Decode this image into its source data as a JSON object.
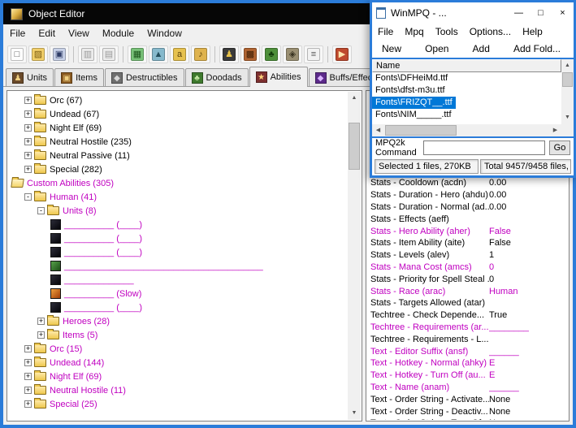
{
  "colors": {
    "frame_blue": "#2b7cd9",
    "custom_magenta": "#c000c0",
    "selection_blue": "#0078d7",
    "titlebar_black": "#060606"
  },
  "editor": {
    "title": "Object Editor",
    "menus": [
      "File",
      "Edit",
      "View",
      "Module",
      "Window"
    ],
    "toolbar_groups": [
      [
        {
          "name": "new-icon",
          "glyph": "□",
          "bg": "#fdfdfd",
          "fg": "#555555"
        },
        {
          "name": "open-folder-icon",
          "glyph": "▨",
          "bg": "#f2cf6a",
          "fg": "#7a5c12"
        },
        {
          "name": "save-icon",
          "glyph": "▣",
          "bg": "#c9d2e8",
          "fg": "#2e3c66"
        }
      ],
      [
        {
          "name": "copy-icon",
          "glyph": "▥",
          "bg": "#ececec",
          "fg": "#9a9a9a"
        },
        {
          "name": "paste-icon",
          "glyph": "▤",
          "bg": "#ececec",
          "fg": "#9a9a9a"
        }
      ],
      [
        {
          "name": "terrain-icon",
          "glyph": "▦",
          "bg": "#79c279",
          "fg": "#1c551c"
        },
        {
          "name": "mountain-icon",
          "glyph": "▲",
          "bg": "#86b9cc",
          "fg": "#234e5c"
        },
        {
          "name": "text-a-icon",
          "glyph": "a",
          "bg": "#e6c14e",
          "fg": "#5a420c"
        },
        {
          "name": "sound-icon",
          "glyph": "♪",
          "bg": "#dfb34e",
          "fg": "#5a420c"
        }
      ],
      [
        {
          "name": "units-icon",
          "glyph": "♟",
          "bg": "#3b3b3b",
          "fg": "#e8c34a"
        },
        {
          "name": "buildings-icon",
          "glyph": "▩",
          "bg": "#b06432",
          "fg": "#3f1f06"
        },
        {
          "name": "trees-icon",
          "glyph": "♣",
          "bg": "#4e8f3a",
          "fg": "#133b0b"
        },
        {
          "name": "doodads-icon",
          "glyph": "◈",
          "bg": "#9a8f72",
          "fg": "#38321f"
        },
        {
          "name": "script-icon",
          "glyph": "≡",
          "bg": "#f2f2f2",
          "fg": "#555555"
        }
      ],
      [
        {
          "name": "test-icon",
          "glyph": "▶",
          "bg": "#bf4a2e",
          "fg": "#ffe6ae"
        }
      ]
    ],
    "tabs": [
      {
        "label": "Units",
        "active": false,
        "icon": {
          "glyph": "♟",
          "bg": "#6b4a2a",
          "fg": "#f0d080"
        }
      },
      {
        "label": "Items",
        "active": false,
        "icon": {
          "glyph": "▣",
          "bg": "#8a5a20",
          "fg": "#f0d080"
        }
      },
      {
        "label": "Destructibles",
        "active": false,
        "icon": {
          "glyph": "◆",
          "bg": "#6f6f6f",
          "fg": "#d8d8d8"
        }
      },
      {
        "label": "Doodads",
        "active": false,
        "icon": {
          "glyph": "♣",
          "bg": "#3f7a2e",
          "fg": "#c6eaa6"
        }
      },
      {
        "label": "Abilities",
        "active": true,
        "icon": {
          "glyph": "★",
          "bg": "#7e3030",
          "fg": "#ffd27a"
        }
      },
      {
        "label": "Buffs/Effects",
        "active": false,
        "icon": {
          "glyph": "◆",
          "bg": "#5c2a8a",
          "fg": "#d9b3ff"
        }
      }
    ],
    "tree": [
      {
        "level": 1,
        "box": "+",
        "icon": "folder",
        "label": "Orc (67)",
        "custom": false
      },
      {
        "level": 1,
        "box": "+",
        "icon": "folder",
        "label": "Undead (67)",
        "custom": false
      },
      {
        "level": 1,
        "box": "+",
        "icon": "folder",
        "label": "Night Elf (69)",
        "custom": false
      },
      {
        "level": 1,
        "box": "+",
        "icon": "folder",
        "label": "Neutral Hostile (235)",
        "custom": false
      },
      {
        "level": 1,
        "box": "+",
        "icon": "folder",
        "label": "Neutral Passive (11)",
        "custom": false
      },
      {
        "level": 1,
        "box": "+",
        "icon": "folder",
        "label": "Special (282)",
        "custom": false
      },
      {
        "level": 0,
        "box": "",
        "icon": "folder-open",
        "label": "Custom Abilities (305)",
        "custom": true
      },
      {
        "level": 1,
        "box": "-",
        "icon": "folder",
        "label": "Human (41)",
        "custom": true
      },
      {
        "level": 2,
        "box": "-",
        "icon": "folder",
        "label": "Units (8)",
        "custom": true
      },
      {
        "level": 3,
        "box": "",
        "icon": "ability-dark",
        "label": "__________ (____)",
        "custom": true
      },
      {
        "level": 3,
        "box": "",
        "icon": "ability-dark",
        "label": "__________ (____)",
        "custom": true
      },
      {
        "level": 3,
        "box": "",
        "icon": "ability-dark",
        "label": "__________ (____)",
        "custom": true
      },
      {
        "level": 3,
        "box": "",
        "icon": "ability-green",
        "label": "________________________________________",
        "custom": true
      },
      {
        "level": 3,
        "box": "",
        "icon": "ability-dark",
        "label": "______________",
        "custom": true
      },
      {
        "level": 3,
        "box": "",
        "icon": "ability-orange",
        "label": "__________ (Slow)",
        "custom": true
      },
      {
        "level": 3,
        "box": "",
        "icon": "ability-dark",
        "label": "__________ (____)",
        "custom": true
      },
      {
        "level": 2,
        "box": "+",
        "icon": "folder",
        "label": "Heroes (28)",
        "custom": true
      },
      {
        "level": 2,
        "box": "+",
        "icon": "folder",
        "label": "Items (5)",
        "custom": true
      },
      {
        "level": 1,
        "box": "+",
        "icon": "folder",
        "label": "Orc (15)",
        "custom": true
      },
      {
        "level": 1,
        "box": "+",
        "icon": "folder",
        "label": "Undead (144)",
        "custom": true
      },
      {
        "level": 1,
        "box": "+",
        "icon": "folder",
        "label": "Night Elf (69)",
        "custom": true
      },
      {
        "level": 1,
        "box": "+",
        "icon": "folder",
        "label": "Neutral Hostile (11)",
        "custom": true
      },
      {
        "level": 1,
        "box": "+",
        "icon": "folder",
        "label": "Special (25)",
        "custom": true
      }
    ],
    "properties": [
      {
        "label": "Stats - Cooldown (acdn)",
        "value": "0.00",
        "modified": false
      },
      {
        "label": "Stats - Duration - Hero (ahdu)",
        "value": "0.00",
        "modified": false
      },
      {
        "label": "Stats - Duration - Normal (ad...",
        "value": "0.00",
        "modified": false
      },
      {
        "label": "Stats - Effects (aeff)",
        "value": "",
        "modified": false
      },
      {
        "label": "Stats - Hero Ability (aher)",
        "value": "False",
        "modified": true
      },
      {
        "label": "Stats - Item Ability (aite)",
        "value": "False",
        "modified": false
      },
      {
        "label": "Stats - Levels (alev)",
        "value": "1",
        "modified": false
      },
      {
        "label": "Stats - Mana Cost (amcs)",
        "value": "0",
        "modified": true
      },
      {
        "label": "Stats - Priority for Spell Steal ...",
        "value": "0",
        "modified": false
      },
      {
        "label": "Stats - Race (arac)",
        "value": "Human",
        "modified": true
      },
      {
        "label": "Stats - Targets Allowed (atar)",
        "value": "",
        "modified": false
      },
      {
        "label": "Techtree - Check Depende...",
        "value": "True",
        "modified": false
      },
      {
        "label": "Techtree - Requirements (ar...",
        "value": "________",
        "modified": true
      },
      {
        "label": "Techtree - Requirements - L...",
        "value": "",
        "modified": false
      },
      {
        "label": "Text - Editor Suffix (ansf)",
        "value": "______",
        "modified": true
      },
      {
        "label": "Text - Hotkey - Normal (ahky)",
        "value": "E",
        "modified": true
      },
      {
        "label": "Text - Hotkey - Turn Off (au...",
        "value": "E",
        "modified": true
      },
      {
        "label": "Text - Name (anam)",
        "value": "______",
        "modified": true
      },
      {
        "label": "Text - Order String - Activate...",
        "value": "None",
        "modified": false
      },
      {
        "label": "Text - Order String - Deactiv...",
        "value": "None",
        "modified": false
      },
      {
        "label": "Text - Order String - Turn Of...",
        "value": "None",
        "modified": false
      }
    ]
  },
  "winmpq": {
    "title": "WinMPQ - ...",
    "window_buttons": [
      "minimize",
      "maximize",
      "close"
    ],
    "menus": [
      "File",
      "Mpq",
      "Tools",
      "Options...",
      "Help"
    ],
    "toolbar": [
      "New",
      "Open",
      "Add",
      "Add Fold..."
    ],
    "list_header": "Name",
    "files": [
      {
        "name": "Fonts\\DFHeiMd.ttf",
        "selected": false
      },
      {
        "name": "Fonts\\dfst-m3u.ttf",
        "selected": false
      },
      {
        "name": "Fonts\\FRIZQT__.ttf",
        "selected": true
      },
      {
        "name": "Fonts\\NIM_____.ttf",
        "selected": false
      }
    ],
    "command_label": "MPQ2k Command",
    "command_value": "",
    "go_label": "Go",
    "status_left": "Selected 1 files, 270KB",
    "status_right": "Total 9457/9458 files,"
  }
}
